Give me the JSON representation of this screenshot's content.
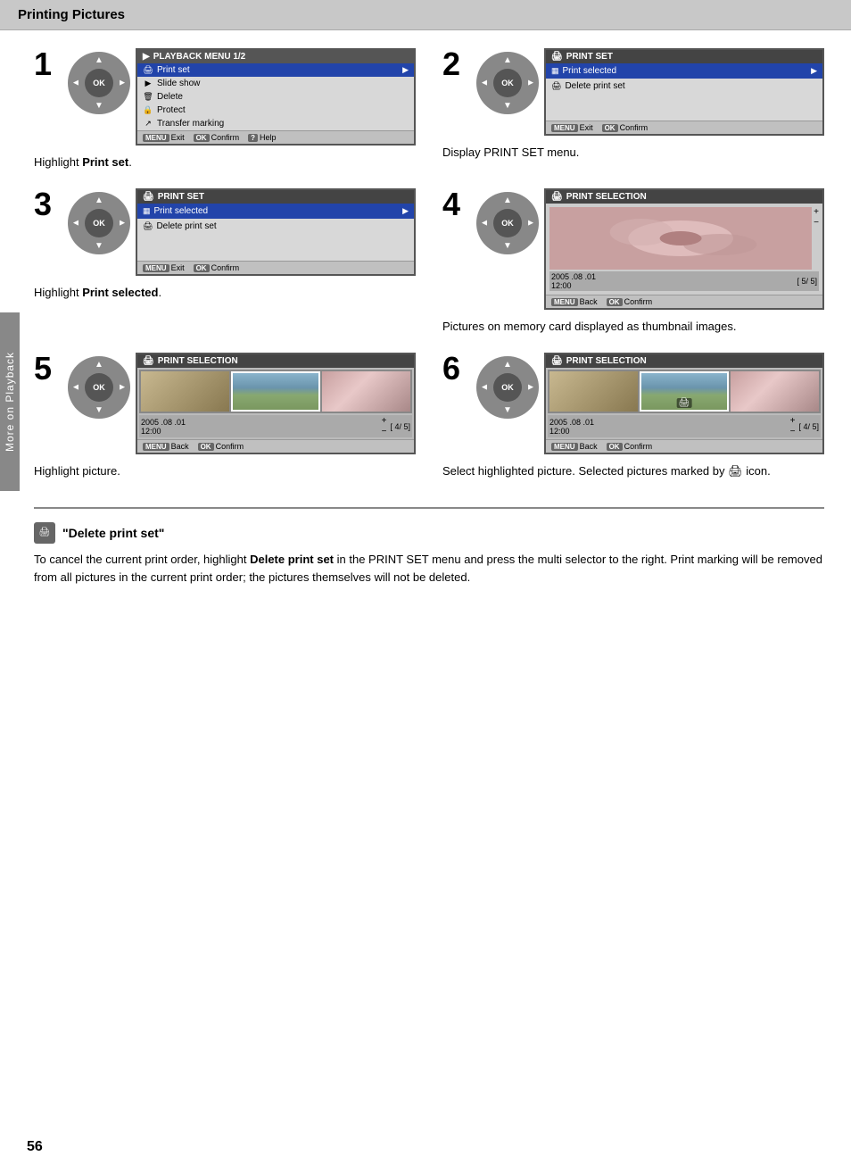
{
  "page": {
    "title": "Printing Pictures",
    "page_number": "56",
    "side_tab": "More on Playback"
  },
  "steps": [
    {
      "number": "1",
      "caption": "Highlight <strong>Print set</strong>.",
      "caption_plain": "Highlight Print set.",
      "screen_type": "playback_menu",
      "screen_title": "PLAYBACK MENU 1/2",
      "menu_items": [
        {
          "label": "Print set",
          "icon": "🖨",
          "highlighted": true
        },
        {
          "label": "Slide show",
          "icon": "▶",
          "highlighted": false
        },
        {
          "label": "Delete",
          "icon": "🗑",
          "highlighted": false
        },
        {
          "label": "Protect",
          "icon": "🔒",
          "highlighted": false
        },
        {
          "label": "Transfer marking",
          "icon": "↗",
          "highlighted": false
        }
      ],
      "footer": [
        {
          "key": "MENU",
          "label": "Exit"
        },
        {
          "key": "OK",
          "label": "Confirm"
        },
        {
          "key": "?",
          "label": "Help"
        }
      ]
    },
    {
      "number": "2",
      "caption": "Display PRINT SET menu.",
      "screen_type": "print_set",
      "screen_title": "PRINT SET",
      "menu_items": [
        {
          "label": "Print selected",
          "icon": "▦",
          "highlighted": true,
          "arrow": true
        },
        {
          "label": "Delete print set",
          "icon": "🖨",
          "highlighted": false,
          "arrow": false
        }
      ],
      "footer": [
        {
          "key": "MENU",
          "label": "Exit"
        },
        {
          "key": "OK",
          "label": "Confirm"
        }
      ]
    },
    {
      "number": "3",
      "caption": "Highlight <strong>Print selected</strong>.",
      "caption_plain": "Highlight Print selected.",
      "screen_type": "print_set",
      "screen_title": "PRINT SET",
      "menu_items": [
        {
          "label": "Print selected",
          "icon": "▦",
          "highlighted": true,
          "arrow": true
        },
        {
          "label": "Delete print set",
          "icon": "🖨",
          "highlighted": false,
          "arrow": false
        }
      ],
      "footer": [
        {
          "key": "MENU",
          "label": "Exit"
        },
        {
          "key": "OK",
          "label": "Confirm"
        }
      ]
    },
    {
      "number": "4",
      "caption": "Pictures on memory card displayed as thumbnail images.",
      "screen_type": "print_selection_large",
      "screen_title": "PRINT SELECTION",
      "date": "2005 .08 .01",
      "time": "12:00",
      "count": "5/ 5",
      "footer": [
        {
          "key": "MENU",
          "label": "Back"
        },
        {
          "key": "OK",
          "label": "Confirm"
        }
      ]
    },
    {
      "number": "5",
      "caption": "Highlight picture.",
      "screen_type": "print_selection_thumb",
      "screen_title": "PRINT SELECTION",
      "date": "2005 .08 .01",
      "time": "12:00",
      "count": "4/ 5",
      "footer": [
        {
          "key": "MENU",
          "label": "Back"
        },
        {
          "key": "OK",
          "label": "Confirm"
        }
      ]
    },
    {
      "number": "6",
      "caption": "Select highlighted picture. Selected pictures marked by 🖨 icon.",
      "screen_type": "print_selection_thumb_marked",
      "screen_title": "PRINT SELECTION",
      "date": "2005 .08 .01",
      "time": "12:00",
      "count": "4/ 5",
      "footer": [
        {
          "key": "MENU",
          "label": "Back"
        },
        {
          "key": "OK",
          "label": "Confirm"
        }
      ]
    }
  ],
  "note": {
    "icon": "🖨",
    "title": "\"Delete print set\"",
    "text": "To cancel the current print order, highlight Delete print set in the PRINT SET menu and press the multi selector to the right. Print marking will be removed from all pictures in the current print order; the pictures themselves will not be deleted."
  }
}
